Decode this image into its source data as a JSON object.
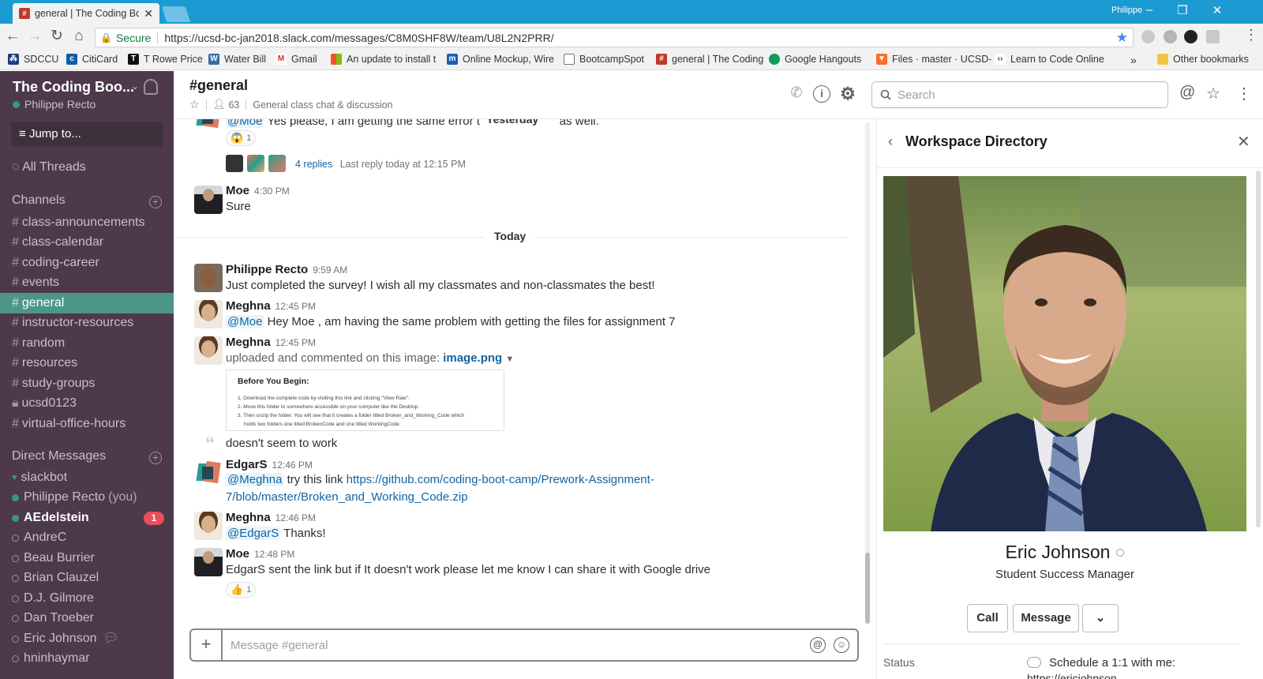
{
  "browser": {
    "tab_title": "general | The Coding Boo",
    "tab_close": "✕",
    "user": "Philippe",
    "secure_label": "Secure",
    "url": "https://ucsd-bc-jan2018.slack.com/messages/C8M0SHF8W/team/U8L2N2PRR/",
    "bookmarks": [
      "SDCCU",
      "CitiCard",
      "T Rowe Price",
      "Water Bill",
      "Gmail",
      "An update to install t",
      "Online Mockup, Wire",
      "BootcampSpot",
      "general | The Coding",
      "Google Hangouts",
      "Files · master · UCSD-",
      "Learn to Code Online"
    ],
    "more_bookmarks": "»",
    "other_bookmarks": "Other bookmarks"
  },
  "sidebar": {
    "team_name": "The Coding Boo...",
    "user_name": "Philippe Recto",
    "jump_to": "Jump to...",
    "all_threads": "All Threads",
    "channels_header": "Channels",
    "channels": [
      "class-announcements",
      "class-calendar",
      "coding-career",
      "events",
      "general",
      "instructor-resources",
      "random",
      "resources",
      "study-groups",
      "ucsd0123",
      "virtual-office-hours"
    ],
    "active_channel": "general",
    "dm_header": "Direct Messages",
    "dms": [
      {
        "name": "slackbot",
        "presence": "heart"
      },
      {
        "name": "Philippe Recto",
        "suffix": "(you)",
        "presence": "online"
      },
      {
        "name": "AEdelstein",
        "presence": "online",
        "unread": "1"
      },
      {
        "name": "AndreC",
        "presence": "away"
      },
      {
        "name": "Beau Burrier",
        "presence": "away"
      },
      {
        "name": "Brian Clauzel",
        "presence": "away"
      },
      {
        "name": "D.J. Gilmore",
        "presence": "away"
      },
      {
        "name": "Dan Troeber",
        "presence": "away"
      },
      {
        "name": "Eric Johnson",
        "presence": "away"
      },
      {
        "name": "hninhaymar",
        "presence": "away"
      }
    ]
  },
  "channel": {
    "title": "#general",
    "member_count": "63",
    "purpose": "General class chat & discussion",
    "search_placeholder": "Search"
  },
  "messages": {
    "floating_date": "Yesterday",
    "prev_mention": "@Moe",
    "prev_text": "Yes please, I am getting the same error tha",
    "prev_tail": "as well.",
    "prev_reaction_count": "1",
    "thread_replies": "4 replies",
    "thread_last": "Last reply today at 12:15 PM",
    "today_label": "Today",
    "m_moe_author": "Moe",
    "m_moe_time": "4:30 PM",
    "m_moe_text": "Sure",
    "m_phil_author": "Philippe Recto",
    "m_phil_time": "9:59 AM",
    "m_phil_text": "Just completed the survey! I wish all my classmates and non-classmates the best!",
    "m_megh1_author": "Meghna",
    "m_megh1_time": "12:45 PM",
    "m_megh1_mention": "@Moe",
    "m_megh1_text": "Hey Moe , am having the same problem with getting the files for assignment 7",
    "m_megh2_author": "Meghna",
    "m_megh2_time": "12:45 PM",
    "m_megh2_text": "uploaded and commented on this image:",
    "m_megh2_file": "image.png",
    "file_title": "Before You Begin:",
    "file_line1": "1. Download the complete code by visiting this link and clicking \"View Raw\".",
    "file_line2": "2. Move this folder to somewhere accessible on your computer like the Desktop.",
    "file_line3": "3. Then unzip the folder. You will see that it creates a folder titled Broken_and_Working_Code which",
    "file_line4": "holds two folders one titled BrokenCode and one titled WorkingCode",
    "m_megh2_comment": "doesn't seem to work",
    "m_edgar_author": "EdgarS",
    "m_edgar_time": "12:46 PM",
    "m_edgar_mention": "@Meghna",
    "m_edgar_text": "try this link",
    "m_edgar_link1": "https://github.com/coding-boot-camp/Prework-Assignment-",
    "m_edgar_link2": "7/blob/master/Broken_and_Working_Code.zip",
    "m_megh3_author": "Meghna",
    "m_megh3_time": "12:46 PM",
    "m_megh3_mention": "@EdgarS",
    "m_megh3_text": "Thanks!",
    "m_moe2_author": "Moe",
    "m_moe2_time": "12:48 PM",
    "m_moe2_text": "EdgarS sent the link but if It doesn't work please let me know I can share it with Google drive",
    "m_moe2_reaction_count": "1"
  },
  "composer": {
    "placeholder": "Message #general"
  },
  "panel": {
    "title": "Workspace Directory",
    "name": "Eric Johnson",
    "role": "Student Success Manager",
    "call": "Call",
    "message": "Message",
    "status_label": "Status",
    "status_text": "Schedule a 1:1 with me:",
    "status_url": "https://ericjohnson..."
  },
  "colors": {
    "sidebar_bg": "#4d394b",
    "active_channel": "#4c9689",
    "browser_tab_bar": "#1b9bd1",
    "link": "#1264a3",
    "unread_badge": "#eb4d5c"
  }
}
